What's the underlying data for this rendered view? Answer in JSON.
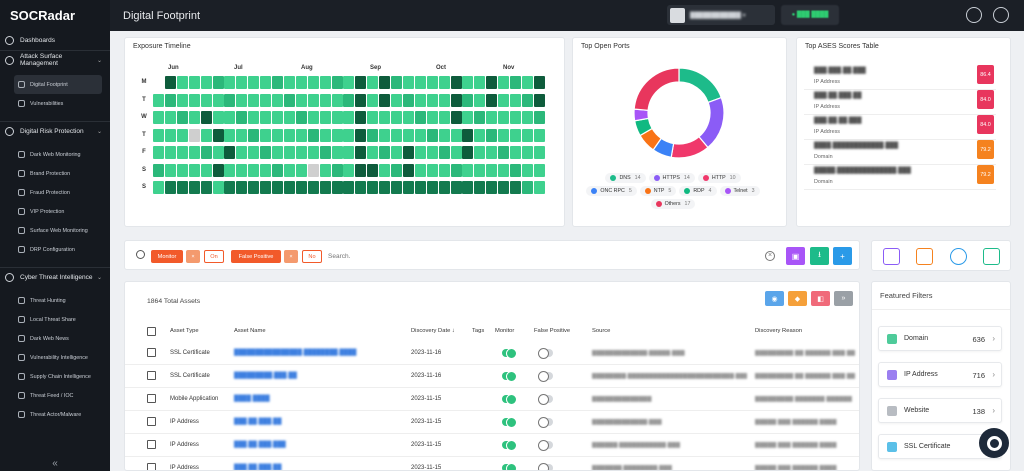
{
  "app": {
    "logo": "SOCRadar",
    "title": "Digital Footprint"
  },
  "topbar": {
    "user_name": "████████████ ▾",
    "status": "● ███ ████"
  },
  "sidebar": {
    "dashboards": "Dashboards",
    "attack_surface": "Attack Surface Management",
    "digital_footprint": "Digital Footprint",
    "vulnerabilities": "Vulnerabilities",
    "digital_risk": "Digital Risk Protection",
    "drp_items": [
      "Dark Web Monitoring",
      "Brand Protection",
      "Fraud Protection",
      "VIP Protection",
      "Surface Web Monitoring",
      "DRP Configuration"
    ],
    "cti": "Cyber Threat Intelligence",
    "cti_items": [
      "Threat Hunting",
      "Local Threat Share",
      "Dark Web News",
      "Vulnerability Intelligence",
      "Supply Chain Intelligence",
      "Threat Feed / IOC",
      "Threat Actor/Malware"
    ],
    "collapse": "«"
  },
  "exposure": {
    "title": "Exposure Timeline",
    "months": [
      "Jun",
      "Jul",
      "Aug",
      "Sep",
      "Oct",
      "Nov"
    ],
    "days": [
      "M",
      "T",
      "W",
      "T",
      "F",
      "S",
      "S"
    ]
  },
  "ports": {
    "title": "Top Open Ports",
    "legend": [
      {
        "name": "DNS",
        "count": "14",
        "color": "#1dbb8a"
      },
      {
        "name": "HTTPS",
        "count": "14",
        "color": "#8b5cf6"
      },
      {
        "name": "HTTP",
        "count": "10",
        "color": "#f0386b"
      },
      {
        "name": "ONC RPC",
        "count": "5",
        "color": "#3b82f6"
      },
      {
        "name": "NTP",
        "count": "5",
        "color": "#f97316"
      },
      {
        "name": "RDP",
        "count": "4",
        "color": "#10b981"
      },
      {
        "name": "Telnet",
        "count": "3",
        "color": "#a855f7"
      },
      {
        "name": "Others",
        "count": "17",
        "color": "#e8365d"
      }
    ]
  },
  "ases": {
    "title": "Top ASES Scores Table",
    "rows": [
      {
        "value": "███.███.██.███",
        "type": "IP Address",
        "score": "86.4",
        "color": "#e8365d"
      },
      {
        "value": "███.██.███.██",
        "type": "IP Address",
        "score": "84.0",
        "color": "#e8365d"
      },
      {
        "value": "███.██.██.███",
        "type": "IP Address",
        "score": "84.0",
        "color": "#e8365d"
      },
      {
        "value": "████.████████████.███",
        "type": "Domain",
        "score": "79.2",
        "color": "#f5821f"
      },
      {
        "value": "█████.██████████████.███",
        "type": "Domain",
        "score": "79.2",
        "color": "#f5821f"
      }
    ]
  },
  "filters": {
    "monitor_label": "Monitor",
    "monitor_value": "On",
    "fp_label": "False Positive",
    "fp_value": "No",
    "search_placeholder": "Search.",
    "x": "×",
    "plus": "+"
  },
  "assets": {
    "total": "1864 Total Assets",
    "columns": [
      "Asset Type",
      "Asset Name",
      "Discovery Date ↓",
      "Tags",
      "Monitor",
      "False Positive",
      "Source",
      "Discovery Reason"
    ],
    "rows": [
      {
        "type": "SSL Certificate",
        "name": "████████████████.████████.████",
        "date": "2023-11-16",
        "source": "█████████████.█████.███",
        "reason": "█████████ ██ ██████ ███ ██"
      },
      {
        "type": "SSL Certificate",
        "name": "█████████.███.██",
        "date": "2023-11-16",
        "source": "████████.█████████████████████████.███",
        "reason": "█████████ ██ ██████ ███ ██"
      },
      {
        "type": "Mobile Application",
        "name": "████ ████",
        "date": "2023-11-15",
        "source": "██████████████",
        "reason": "█████████ ███████ ██████"
      },
      {
        "type": "IP Address",
        "name": "███.██.███.██",
        "date": "2023-11-15",
        "source": "█████████████.███",
        "reason": "█████ ███ ██████ ████"
      },
      {
        "type": "IP Address",
        "name": "███.██.███.███",
        "date": "2023-11-15",
        "source": "██████.███████████.███",
        "reason": "█████ ███ ██████ ████"
      },
      {
        "type": "IP Address",
        "name": "███.██.███.██",
        "date": "2023-11-15",
        "source": "███████.████████.███",
        "reason": "█████ ███ ██████ ████"
      }
    ]
  },
  "featured": {
    "title": "Featured Filters",
    "items": [
      {
        "label": "Domain",
        "count": "636",
        "color": "#4ecb9a"
      },
      {
        "label": "IP Address",
        "count": "716",
        "color": "#9b7ff0"
      },
      {
        "label": "Website",
        "count": "138",
        "color": "#b8bcc2"
      },
      {
        "label": "SSL Certificate",
        "count": "1",
        "color": "#5bc0e8"
      }
    ]
  },
  "colors": {
    "accent_green": "#1dbb8a",
    "danger": "#e8365d",
    "orange": "#f5821f",
    "purple": "#a855f7",
    "blue": "#3b82f6"
  }
}
